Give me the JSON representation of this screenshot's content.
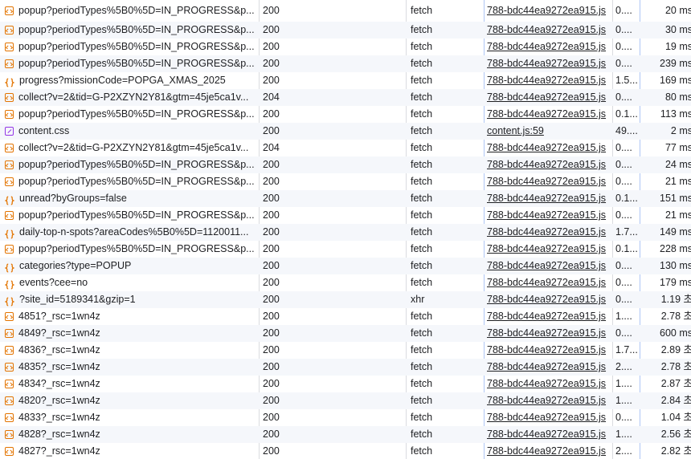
{
  "network": {
    "rows": [
      {
        "name": "popup?periodTypes%5B0%5D=IN_PROGRESS&p...",
        "icon": "fetch-icon",
        "status": "200",
        "type": "fetch",
        "initiator": "788-bdc44ea9272ea915.js",
        "size": "0....",
        "time": "20 ms"
      },
      {
        "name": "popup?periodTypes%5B0%5D=IN_PROGRESS&p...",
        "icon": "fetch-icon",
        "status": "200",
        "type": "fetch",
        "initiator": "788-bdc44ea9272ea915.js",
        "size": "0....",
        "time": "30 ms"
      },
      {
        "name": "popup?periodTypes%5B0%5D=IN_PROGRESS&p...",
        "icon": "fetch-icon",
        "status": "200",
        "type": "fetch",
        "initiator": "788-bdc44ea9272ea915.js",
        "size": "0....",
        "time": "19 ms"
      },
      {
        "name": "popup?periodTypes%5B0%5D=IN_PROGRESS&p...",
        "icon": "fetch-icon",
        "status": "200",
        "type": "fetch",
        "initiator": "788-bdc44ea9272ea915.js",
        "size": "0....",
        "time": "239 ms"
      },
      {
        "name": "progress?missionCode=POPGA_XMAS_2025",
        "icon": "braces-icon",
        "status": "200",
        "type": "fetch",
        "initiator": "788-bdc44ea9272ea915.js",
        "size": "1.5...",
        "time": "169 ms"
      },
      {
        "name": "collect?v=2&tid=G-P2XZYN2Y81&gtm=45je5ca1v...",
        "icon": "fetch-icon",
        "status": "204",
        "type": "fetch",
        "initiator": "788-bdc44ea9272ea915.js",
        "size": "0....",
        "time": "80 ms"
      },
      {
        "name": "popup?periodTypes%5B0%5D=IN_PROGRESS&p...",
        "icon": "fetch-icon",
        "status": "200",
        "type": "fetch",
        "initiator": "788-bdc44ea9272ea915.js",
        "size": "0.1...",
        "time": "113 ms"
      },
      {
        "name": "content.css",
        "icon": "css-icon",
        "status": "200",
        "type": "fetch",
        "initiator": "content.js:59",
        "size": "49....",
        "time": "2 ms"
      },
      {
        "name": "collect?v=2&tid=G-P2XZYN2Y81&gtm=45je5ca1v...",
        "icon": "fetch-icon",
        "status": "204",
        "type": "fetch",
        "initiator": "788-bdc44ea9272ea915.js",
        "size": "0....",
        "time": "77 ms"
      },
      {
        "name": "popup?periodTypes%5B0%5D=IN_PROGRESS&p...",
        "icon": "fetch-icon",
        "status": "200",
        "type": "fetch",
        "initiator": "788-bdc44ea9272ea915.js",
        "size": "0....",
        "time": "24 ms"
      },
      {
        "name": "popup?periodTypes%5B0%5D=IN_PROGRESS&p...",
        "icon": "fetch-icon",
        "status": "200",
        "type": "fetch",
        "initiator": "788-bdc44ea9272ea915.js",
        "size": "0....",
        "time": "21 ms"
      },
      {
        "name": "unread?byGroups=false",
        "icon": "braces-icon",
        "status": "200",
        "type": "fetch",
        "initiator": "788-bdc44ea9272ea915.js",
        "size": "0.1...",
        "time": "151 ms"
      },
      {
        "name": "popup?periodTypes%5B0%5D=IN_PROGRESS&p...",
        "icon": "fetch-icon",
        "status": "200",
        "type": "fetch",
        "initiator": "788-bdc44ea9272ea915.js",
        "size": "0....",
        "time": "21 ms"
      },
      {
        "name": "daily-top-n-spots?areaCodes%5B0%5D=1120011...",
        "icon": "braces-icon",
        "status": "200",
        "type": "fetch",
        "initiator": "788-bdc44ea9272ea915.js",
        "size": "1.7...",
        "time": "149 ms"
      },
      {
        "name": "popup?periodTypes%5B0%5D=IN_PROGRESS&p...",
        "icon": "fetch-icon",
        "status": "200",
        "type": "fetch",
        "initiator": "788-bdc44ea9272ea915.js",
        "size": "0.1...",
        "time": "228 ms"
      },
      {
        "name": "categories?type=POPUP",
        "icon": "braces-icon",
        "status": "200",
        "type": "fetch",
        "initiator": "788-bdc44ea9272ea915.js",
        "size": "0....",
        "time": "130 ms"
      },
      {
        "name": "events?cee=no",
        "icon": "braces-icon",
        "status": "200",
        "type": "fetch",
        "initiator": "788-bdc44ea9272ea915.js",
        "size": "0....",
        "time": "179 ms"
      },
      {
        "name": "?site_id=5189341&gzip=1",
        "icon": "braces-icon",
        "status": "200",
        "type": "xhr",
        "initiator": "788-bdc44ea9272ea915.js",
        "size": "0....",
        "time": "1.19 초"
      },
      {
        "name": "4851?_rsc=1wn4z",
        "icon": "fetch-icon",
        "status": "200",
        "type": "fetch",
        "initiator": "788-bdc44ea9272ea915.js",
        "size": "1....",
        "time": "2.78 초"
      },
      {
        "name": "4849?_rsc=1wn4z",
        "icon": "fetch-icon",
        "status": "200",
        "type": "fetch",
        "initiator": "788-bdc44ea9272ea915.js",
        "size": "0....",
        "time": "600 ms"
      },
      {
        "name": "4836?_rsc=1wn4z",
        "icon": "fetch-icon",
        "status": "200",
        "type": "fetch",
        "initiator": "788-bdc44ea9272ea915.js",
        "size": "1.7...",
        "time": "2.89 초"
      },
      {
        "name": "4835?_rsc=1wn4z",
        "icon": "fetch-icon",
        "status": "200",
        "type": "fetch",
        "initiator": "788-bdc44ea9272ea915.js",
        "size": "2....",
        "time": "2.78 초"
      },
      {
        "name": "4834?_rsc=1wn4z",
        "icon": "fetch-icon",
        "status": "200",
        "type": "fetch",
        "initiator": "788-bdc44ea9272ea915.js",
        "size": "1....",
        "time": "2.87 초"
      },
      {
        "name": "4820?_rsc=1wn4z",
        "icon": "fetch-icon",
        "status": "200",
        "type": "fetch",
        "initiator": "788-bdc44ea9272ea915.js",
        "size": "1....",
        "time": "2.84 초"
      },
      {
        "name": "4833?_rsc=1wn4z",
        "icon": "fetch-icon",
        "status": "200",
        "type": "fetch",
        "initiator": "788-bdc44ea9272ea915.js",
        "size": "0....",
        "time": "1.04 초"
      },
      {
        "name": "4828?_rsc=1wn4z",
        "icon": "fetch-icon",
        "status": "200",
        "type": "fetch",
        "initiator": "788-bdc44ea9272ea915.js",
        "size": "1....",
        "time": "2.56 초"
      },
      {
        "name": "4827?_rsc=1wn4z",
        "icon": "fetch-icon",
        "status": "200",
        "type": "fetch",
        "initiator": "788-bdc44ea9272ea915.js",
        "size": "2....",
        "time": "2.82 초"
      }
    ]
  },
  "colors": {
    "stripe": "#f5f7fb",
    "fetch_icon": "#e37400",
    "css_icon": "#9334e6",
    "divider": "#dadce0",
    "initiator_divider": "#aec6f5"
  }
}
